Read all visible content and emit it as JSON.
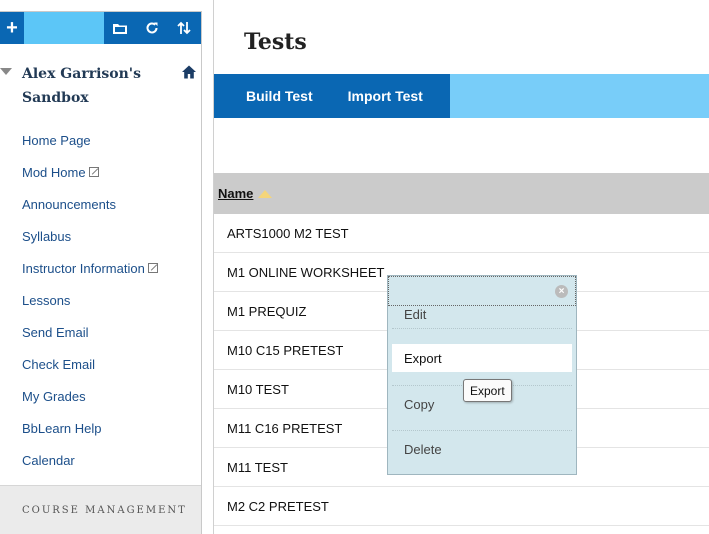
{
  "sidebar": {
    "add_label": "+",
    "course_title": "Alex Garrison's Sandbox",
    "menu": [
      {
        "label": "Home Page",
        "external": false
      },
      {
        "label": "Mod Home",
        "external": true
      },
      {
        "label": "Announcements",
        "external": false
      },
      {
        "label": "Syllabus",
        "external": false
      },
      {
        "label": "Instructor Information",
        "external": true
      },
      {
        "label": "Lessons",
        "external": false
      },
      {
        "label": "Send Email",
        "external": false
      },
      {
        "label": "Check Email",
        "external": false
      },
      {
        "label": "My Grades",
        "external": false
      },
      {
        "label": "BbLearn Help",
        "external": false
      },
      {
        "label": "Calendar",
        "external": false
      }
    ],
    "footer": "COURSE MANAGEMENT",
    "icons": [
      "folder-icon",
      "refresh-icon",
      "sort-icon",
      "home-icon",
      "collapse-triangle-icon"
    ]
  },
  "main": {
    "title": "Tests",
    "actions": {
      "build": "Build Test",
      "import": "Import Test"
    },
    "column_header": "Name",
    "rows": [
      "ARTS1000 M2 TEST",
      "M1 ONLINE WORKSHEET",
      "M1 PREQUIZ",
      "M10 C15 PRETEST",
      "M10 TEST",
      "M11 C16 PRETEST",
      "M11 TEST",
      "M2 C2 PRETEST"
    ]
  },
  "context_menu": {
    "items": {
      "edit": "Edit",
      "export": "Export",
      "copy": "Copy",
      "delete": "Delete"
    },
    "close_symbol": "×",
    "tooltip": "Export"
  },
  "colors": {
    "brand_blue": "#0a67b3",
    "light_blue": "#78cdf9",
    "menu_bg": "#d3e7ed",
    "header_gray": "#cbcbcb"
  }
}
